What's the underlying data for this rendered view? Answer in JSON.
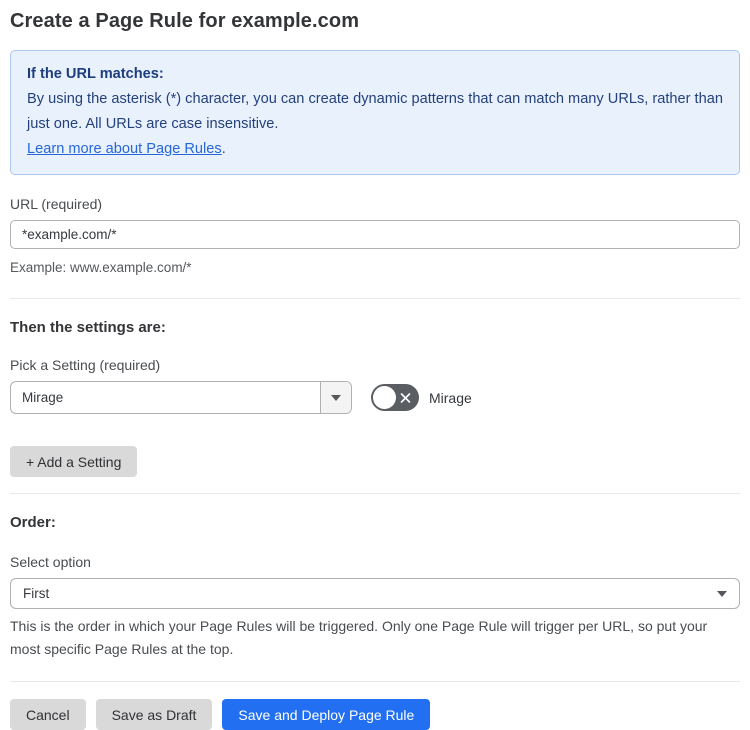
{
  "page": {
    "title": "Create a Page Rule for example.com"
  },
  "info_box": {
    "heading": "If the URL matches:",
    "body": "By using the asterisk (*) character, you can create dynamic patterns that can match many URLs, rather than just one. All URLs are case insensitive.",
    "link_label": "Learn more about Page Rules",
    "link_suffix": "."
  },
  "url_field": {
    "label": "URL (required)",
    "value": "*example.com/*",
    "helper": "Example: www.example.com/*"
  },
  "settings_section": {
    "heading": "Then the settings are:",
    "setting_label": "Pick a Setting (required)",
    "setting_value": "Mirage",
    "toggle_label": "Mirage",
    "toggle_state": "off",
    "add_button_label": "+ Add a Setting"
  },
  "order_section": {
    "heading": "Order:",
    "select_label": "Select option",
    "select_value": "First",
    "helper": "This is the order in which your Page Rules will be triggered. Only one Page Rule will trigger per URL, so put your most specific Page Rules at the top."
  },
  "footer": {
    "cancel_label": "Cancel",
    "save_draft_label": "Save as Draft",
    "save_deploy_label": "Save and Deploy Page Rule"
  },
  "colors": {
    "info_box_bg": "#e9f1fc",
    "info_box_border": "#abc9ef",
    "info_text": "#24417d",
    "link_blue": "#2666d9",
    "primary_button_blue": "#2270f1",
    "gray_button": "#d9d9d9",
    "toggle_off_gray": "#5a5e63"
  }
}
